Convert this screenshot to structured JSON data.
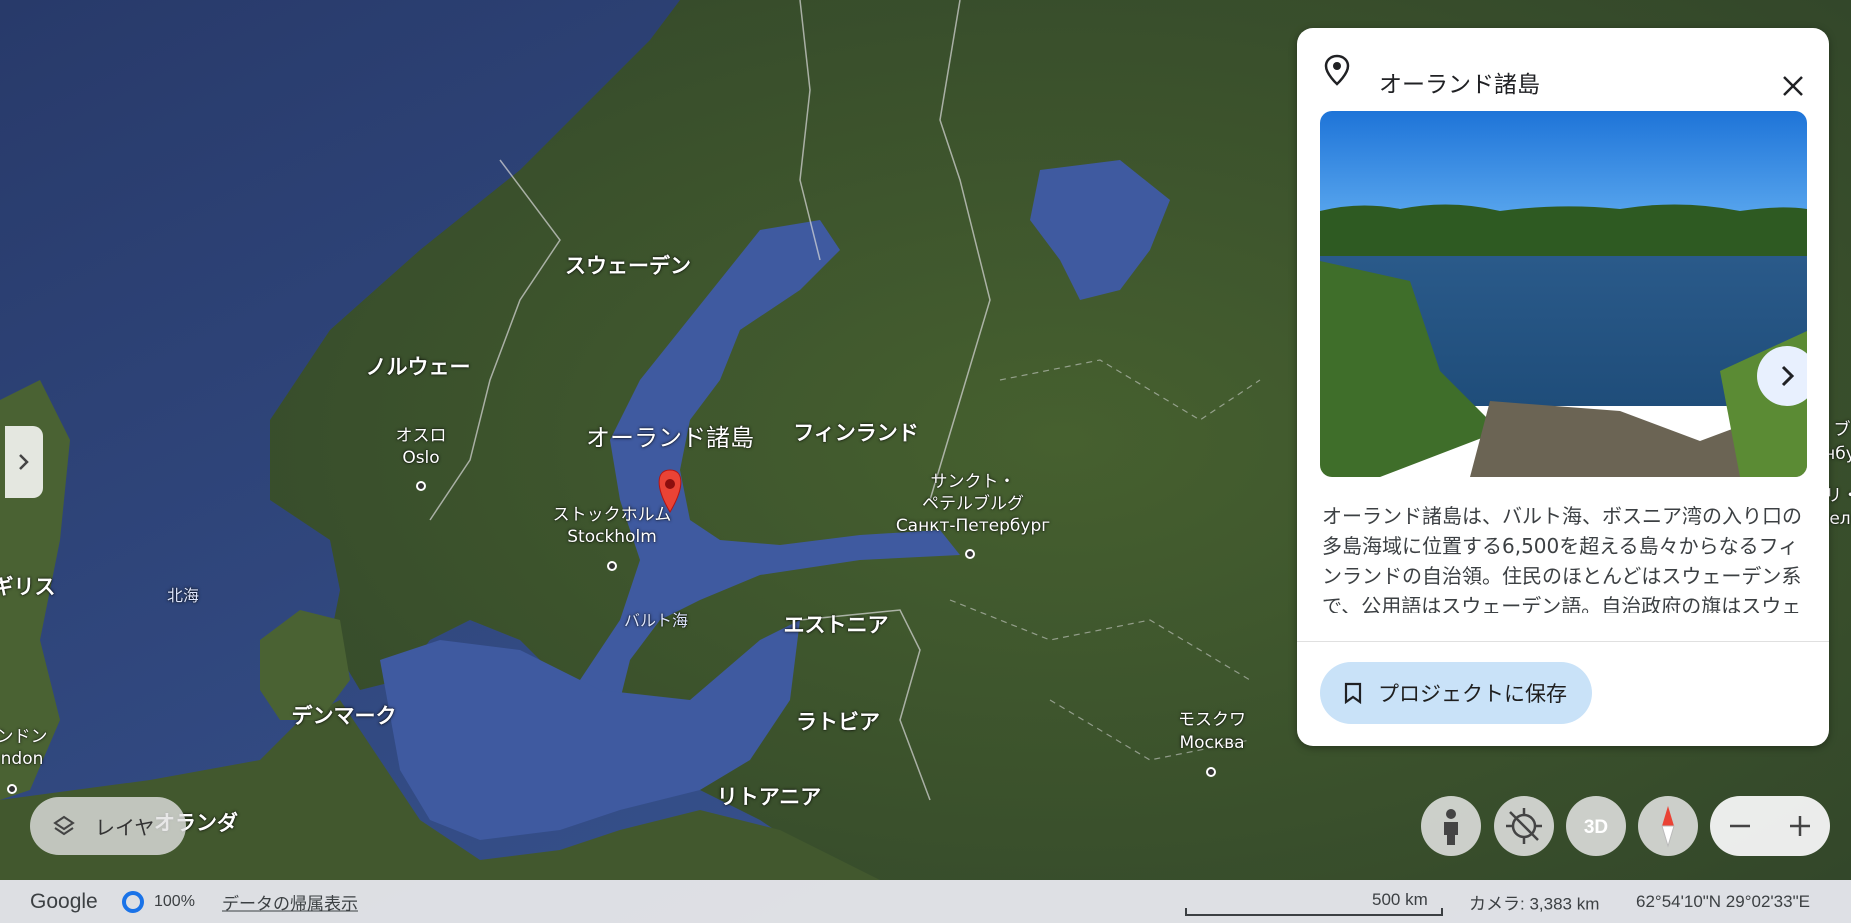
{
  "map": {
    "countries": [
      {
        "id": "sweden",
        "text": "スウェーデン"
      },
      {
        "id": "norway",
        "text": "ノルウェー"
      },
      {
        "id": "finland",
        "text": "フィンランド"
      },
      {
        "id": "estonia",
        "text": "エストニア"
      },
      {
        "id": "latvia",
        "text": "ラトビア"
      },
      {
        "id": "lithuania",
        "text": "リトアニア"
      },
      {
        "id": "denmark",
        "text": "デンマーク"
      },
      {
        "id": "netherlands",
        "text": "オランダ"
      },
      {
        "id": "uk",
        "text": "ギリス"
      }
    ],
    "cities": {
      "oslo_ja": "オスロ",
      "oslo": "Oslo",
      "stockholm_ja": "ストックホルム",
      "stockholm": "Stockholm",
      "spb_ja1": "サンクト・",
      "spb_ja2": "ペテルブルグ",
      "spb": "Санкт-Петербург",
      "moscow_ja": "モスクワ",
      "moscow": "Москва",
      "london_ja": "ンドン",
      "london": "ndon"
    },
    "seas": {
      "north_sea": "北海",
      "baltic_sea": "バルト海"
    },
    "poi_label": "オーランド諸島",
    "edge_right": [
      "ブ",
      "нбу",
      "リ・",
      "ел"
    ]
  },
  "card": {
    "title": "オーランド諸島",
    "description": "オーランド諸島は、バルト海、ボスニア湾の入り口の多島海域に位置する6,500を超える島々からなるフィンランドの自治領。住民のほとんどはスウェーデン系で、公用語はスウェーデン語。自治政府の旗はスウェーデンの国旗の意匠である青地に黄色の十",
    "save_label": "プロジェクトに保存"
  },
  "controls": {
    "layers_label": "レイヤ",
    "three_d_label": "3D"
  },
  "bottom_bar": {
    "logo": "Google",
    "loading_percent": "100%",
    "attribution": "データの帰属表示",
    "scale": "500 km",
    "camera": "カメラ: 3,383 km",
    "coordinates": "62°54'10\"N 29°02'33\"E"
  },
  "colors": {
    "accent": "#1a73e8",
    "pin": "#ea4335",
    "save_button_bg": "#c9e2f8",
    "ocean": "#3a4c7a",
    "land": "#3f5a32"
  }
}
